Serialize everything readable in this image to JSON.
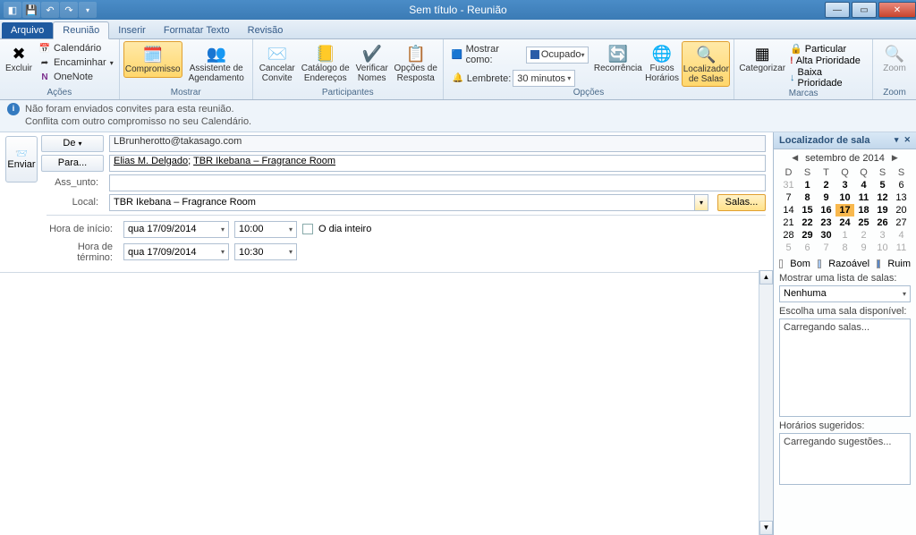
{
  "title": "Sem título  -  Reunião",
  "tabs": {
    "file": "Arquivo",
    "items": [
      "Reunião",
      "Inserir",
      "Formatar Texto",
      "Revisão"
    ]
  },
  "ribbon": {
    "excluir": "Excluir",
    "acoes": {
      "calendario": "Calendário",
      "encaminhar": "Encaminhar",
      "onenote": "OneNote",
      "label": "Ações"
    },
    "mostrar": {
      "compromisso": "Compromisso",
      "assistente": "Assistente de\nAgendamento",
      "label": "Mostrar"
    },
    "participantes": {
      "cancelar": "Cancelar\nConvite",
      "catalogo": "Catálogo de\nEndereços",
      "verificar": "Verificar\nNomes",
      "opcoes": "Opções de\nResposta",
      "label": "Participantes"
    },
    "opcoes": {
      "mostrar_como_lbl": "Mostrar como:",
      "mostrar_como_val": "Ocupado",
      "lembrete_lbl": "Lembrete:",
      "lembrete_val": "30 minutos",
      "recorrencia": "Recorrência",
      "fusos": "Fusos\nHorários",
      "localizador": "Localizador\nde Salas",
      "label": "Opções"
    },
    "marcas": {
      "categorizar": "Categorizar",
      "particular": "Particular",
      "alta": "Alta Prioridade",
      "baixa": "Baixa Prioridade",
      "label": "Marcas"
    },
    "zoom": {
      "zoom": "Zoom",
      "label": "Zoom"
    }
  },
  "info": {
    "line1": "Não foram enviados convites para esta reunião.",
    "line2": "Conflita com outro compromisso no seu Calendário."
  },
  "form": {
    "send": "Enviar",
    "de_btn": "De",
    "de_val": "LBrunherotto@takasago.com",
    "para_btn": "Para...",
    "para_val_1": "Elias M. Delgado",
    "para_val_2": "TBR Ikebana – Fragrance Room",
    "assunto_lbl": "Ass_unto:",
    "assunto_val": "",
    "local_lbl": "Local:",
    "local_val": "TBR Ikebana – Fragrance Room",
    "salas_btn": "Salas...",
    "inicio_lbl": "Hora de início:",
    "termino_lbl": "Hora de término:",
    "date_start": "qua 17/09/2014",
    "time_start": "10:00",
    "date_end": "qua 17/09/2014",
    "time_end": "10:30",
    "dia_inteiro": "O dia inteiro"
  },
  "rf": {
    "title": "Localizador de sala",
    "month": "setembro de 2014",
    "dow": [
      "D",
      "S",
      "T",
      "Q",
      "Q",
      "S",
      "S"
    ],
    "weeks": [
      [
        {
          "d": 31,
          "dim": true
        },
        {
          "d": 1,
          "b": true
        },
        {
          "d": 2,
          "b": true
        },
        {
          "d": 3,
          "b": true
        },
        {
          "d": 4,
          "b": true
        },
        {
          "d": 5,
          "b": true
        },
        {
          "d": 6
        }
      ],
      [
        {
          "d": 7
        },
        {
          "d": 8,
          "b": true
        },
        {
          "d": 9,
          "b": true
        },
        {
          "d": 10,
          "b": true
        },
        {
          "d": 11,
          "b": true
        },
        {
          "d": 12,
          "b": true
        },
        {
          "d": 13
        }
      ],
      [
        {
          "d": 14
        },
        {
          "d": 15,
          "b": true
        },
        {
          "d": 16,
          "b": true
        },
        {
          "d": 17,
          "today": true,
          "b": true
        },
        {
          "d": 18,
          "b": true
        },
        {
          "d": 19,
          "b": true
        },
        {
          "d": 20
        }
      ],
      [
        {
          "d": 21
        },
        {
          "d": 22,
          "b": true
        },
        {
          "d": 23,
          "b": true
        },
        {
          "d": 24,
          "b": true
        },
        {
          "d": 25,
          "b": true
        },
        {
          "d": 26,
          "b": true
        },
        {
          "d": 27
        }
      ],
      [
        {
          "d": 28
        },
        {
          "d": 29,
          "b": true
        },
        {
          "d": 30,
          "b": true
        },
        {
          "d": 1,
          "dim": true
        },
        {
          "d": 2,
          "dim": true
        },
        {
          "d": 3,
          "dim": true
        },
        {
          "d": 4,
          "dim": true
        }
      ],
      [
        {
          "d": 5,
          "dim": true
        },
        {
          "d": 6,
          "dim": true
        },
        {
          "d": 7,
          "dim": true
        },
        {
          "d": 8,
          "dim": true
        },
        {
          "d": 9,
          "dim": true
        },
        {
          "d": 10,
          "dim": true
        },
        {
          "d": 11,
          "dim": true
        }
      ]
    ],
    "legend": {
      "bom": "Bom",
      "razoavel": "Razoável",
      "ruim": "Ruim"
    },
    "lista_lbl": "Mostrar uma lista de salas:",
    "lista_val": "Nenhuma",
    "escolha_lbl": "Escolha uma sala disponível:",
    "escolha_msg": "Carregando salas...",
    "horarios_lbl": "Horários sugeridos:",
    "horarios_msg": "Carregando sugestões..."
  }
}
